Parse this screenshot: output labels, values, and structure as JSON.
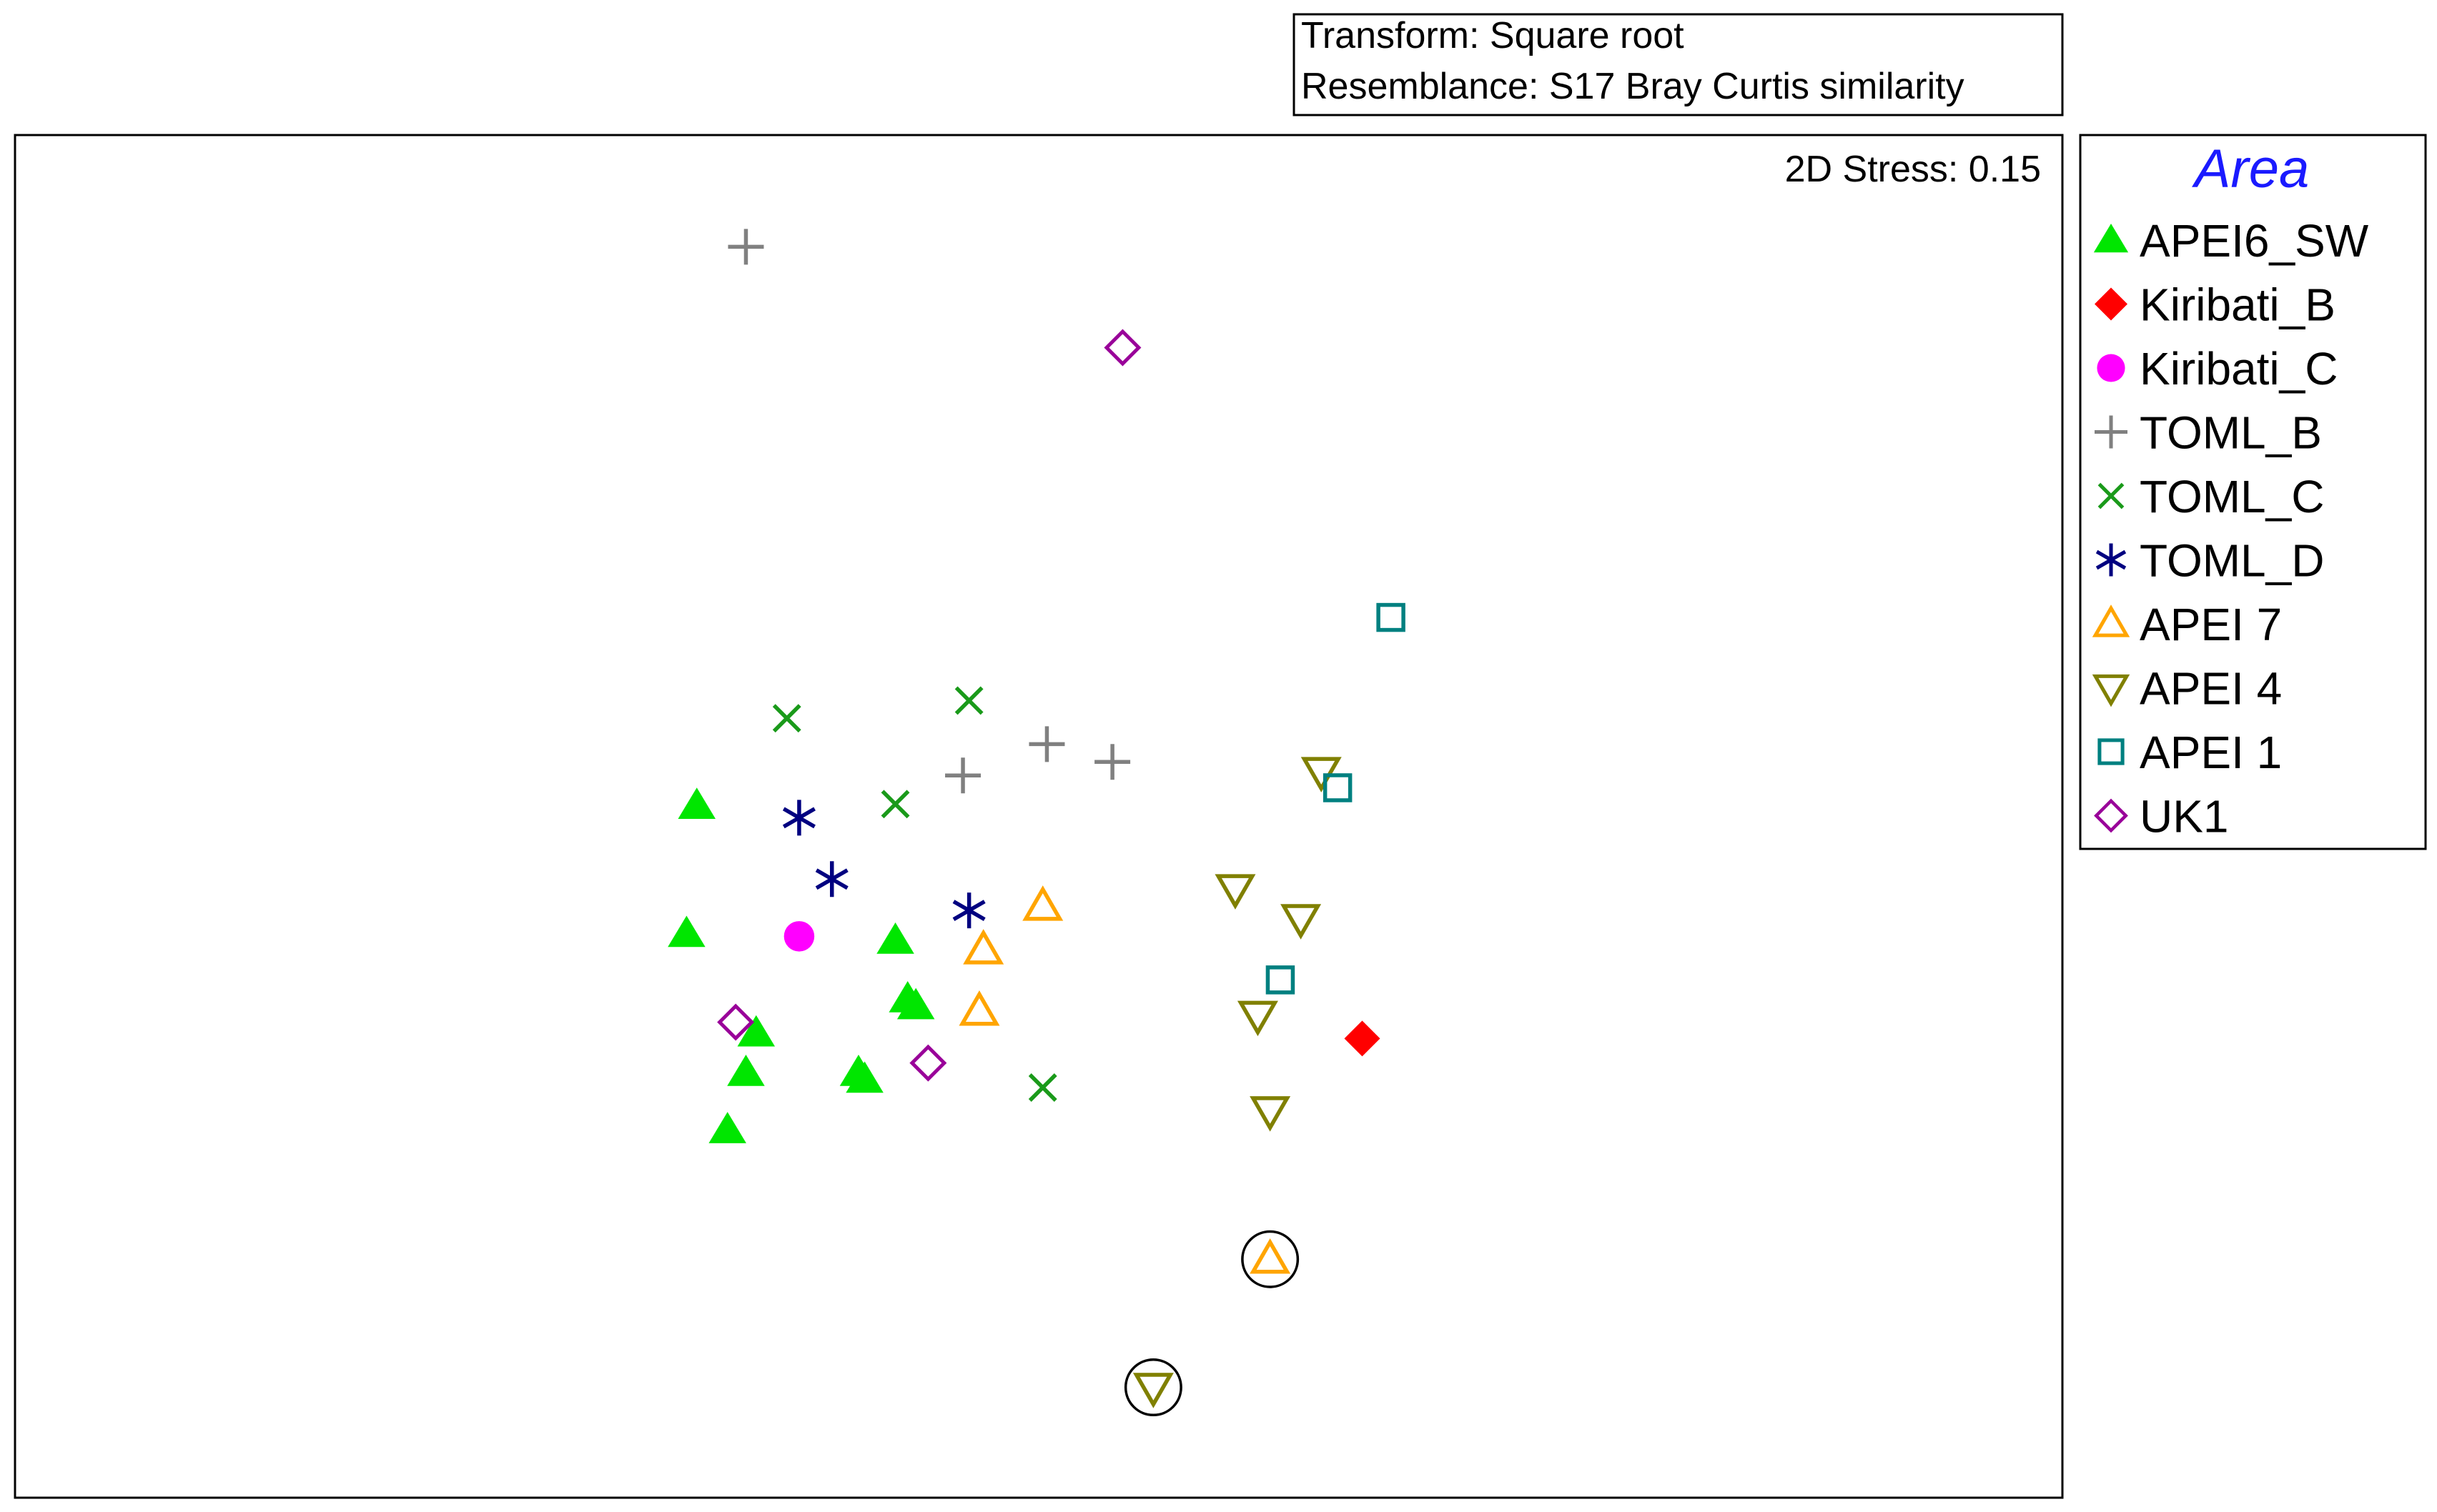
{
  "transform_box": {
    "line1": "Transform: Square root",
    "line2": "Resemblance: S17 Bray Curtis similarity"
  },
  "stress_label": "2D Stress: 0.15",
  "chart_data": {
    "type": "scatter",
    "title": "",
    "xlabel": "",
    "ylabel": "",
    "grid": false,
    "xlim": [
      0,
      100
    ],
    "ylim": [
      0,
      100
    ],
    "legend": {
      "title": "Area",
      "placement": "right",
      "title_color": "#1a1aff"
    },
    "series": [
      {
        "name": "APEI6_SW",
        "marker": "triangle-filled",
        "color": "#00e600",
        "points": [
          {
            "x": 33.3,
            "y": 50.8
          },
          {
            "x": 32.8,
            "y": 41.4
          },
          {
            "x": 43.0,
            "y": 40.9
          },
          {
            "x": 43.6,
            "y": 36.6
          },
          {
            "x": 44.0,
            "y": 36.1
          },
          {
            "x": 36.2,
            "y": 34.1
          },
          {
            "x": 35.7,
            "y": 31.2
          },
          {
            "x": 41.2,
            "y": 31.2
          },
          {
            "x": 41.5,
            "y": 30.7
          },
          {
            "x": 34.8,
            "y": 27.0
          }
        ]
      },
      {
        "name": "Kiribati_B",
        "marker": "diamond-filled",
        "color": "#ff0000",
        "points": [
          {
            "x": 65.8,
            "y": 33.7
          }
        ]
      },
      {
        "name": "Kiribati_C",
        "marker": "circle-filled",
        "color": "#ff00ff",
        "points": [
          {
            "x": 38.3,
            "y": 41.2
          }
        ]
      },
      {
        "name": "TOML_B",
        "marker": "plus",
        "color": "#808080",
        "points": [
          {
            "x": 35.7,
            "y": 91.8
          },
          {
            "x": 46.3,
            "y": 53.0
          },
          {
            "x": 50.4,
            "y": 55.3
          },
          {
            "x": 53.6,
            "y": 54.0
          }
        ]
      },
      {
        "name": "TOML_C",
        "marker": "x",
        "color": "#1a9a1a",
        "points": [
          {
            "x": 37.7,
            "y": 57.2
          },
          {
            "x": 46.6,
            "y": 58.5
          },
          {
            "x": 43.0,
            "y": 50.9
          },
          {
            "x": 50.2,
            "y": 30.1
          }
        ]
      },
      {
        "name": "TOML_D",
        "marker": "asterisk",
        "color": "#000080",
        "points": [
          {
            "x": 38.3,
            "y": 49.9
          },
          {
            "x": 39.9,
            "y": 45.4
          },
          {
            "x": 46.6,
            "y": 43.1
          }
        ]
      },
      {
        "name": "APEI 7",
        "marker": "triangle-open",
        "color": "#ffa500",
        "points": [
          {
            "x": 50.2,
            "y": 43.4
          },
          {
            "x": 47.3,
            "y": 40.2
          },
          {
            "x": 47.1,
            "y": 35.7
          },
          {
            "x": 61.3,
            "y": 17.5,
            "circled": true
          }
        ]
      },
      {
        "name": "APEI 4",
        "marker": "triangle-down-open",
        "color": "#808000",
        "points": [
          {
            "x": 63.8,
            "y": 53.3
          },
          {
            "x": 59.6,
            "y": 44.7
          },
          {
            "x": 62.8,
            "y": 42.5
          },
          {
            "x": 60.7,
            "y": 35.4
          },
          {
            "x": 61.3,
            "y": 28.4
          },
          {
            "x": 55.6,
            "y": 8.1,
            "circled": true
          }
        ]
      },
      {
        "name": "APEI 1",
        "marker": "square-open",
        "color": "#008080",
        "points": [
          {
            "x": 67.2,
            "y": 64.6
          },
          {
            "x": 64.6,
            "y": 52.1
          },
          {
            "x": 61.8,
            "y": 38.0
          }
        ]
      },
      {
        "name": "UK1",
        "marker": "diamond-open",
        "color": "#990099",
        "points": [
          {
            "x": 54.1,
            "y": 84.4
          },
          {
            "x": 35.2,
            "y": 34.9
          },
          {
            "x": 44.6,
            "y": 31.9
          }
        ]
      }
    ]
  }
}
